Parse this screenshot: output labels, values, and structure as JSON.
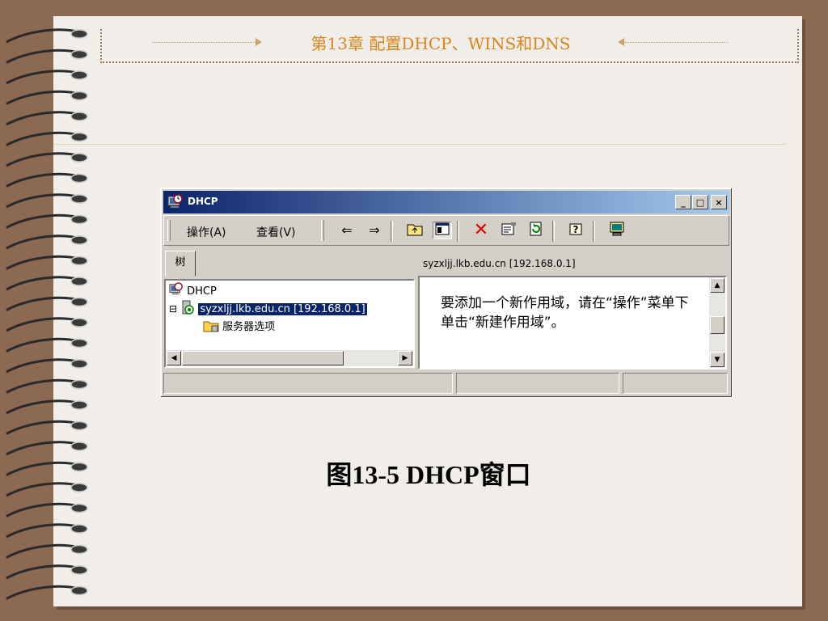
{
  "slide": {
    "header_title": "第13章   配置DHCP、WINS和DNS",
    "caption": "图13-5  DHCP窗口"
  },
  "window": {
    "title": "DHCP",
    "controls": {
      "minimize": "_",
      "maximize": "□",
      "close": "×"
    },
    "menus": [
      {
        "label": "操作(A)"
      },
      {
        "label": "查看(V)"
      }
    ],
    "toolbar_icons": [
      "back-arrow-icon",
      "forward-arrow-icon",
      "up-folder-icon",
      "show-hide-tree-icon",
      "delete-icon",
      "properties-icon",
      "refresh-icon",
      "help-icon",
      "console-icon"
    ],
    "tab_label": "树",
    "right_header": "syzxljj.lkb.edu.cn [192.168.0.1]",
    "tree": [
      {
        "label": "DHCP",
        "icon": "dhcp-clock-icon"
      },
      {
        "label": "syzxljj.lkb.edu.cn [192.168.0.1]",
        "icon": "server-icon",
        "expander": "⊟",
        "selected": true
      },
      {
        "label": "服务器选项",
        "icon": "folder-icon"
      }
    ],
    "info_text": "要添加一个新作用域，请在“操作”菜单下单击“新建作用域”。"
  },
  "colors": {
    "titlebar_start": "#0a246a",
    "titlebar_end": "#a6caf0",
    "header_text": "#d9851a",
    "background": "#8c6a52"
  }
}
